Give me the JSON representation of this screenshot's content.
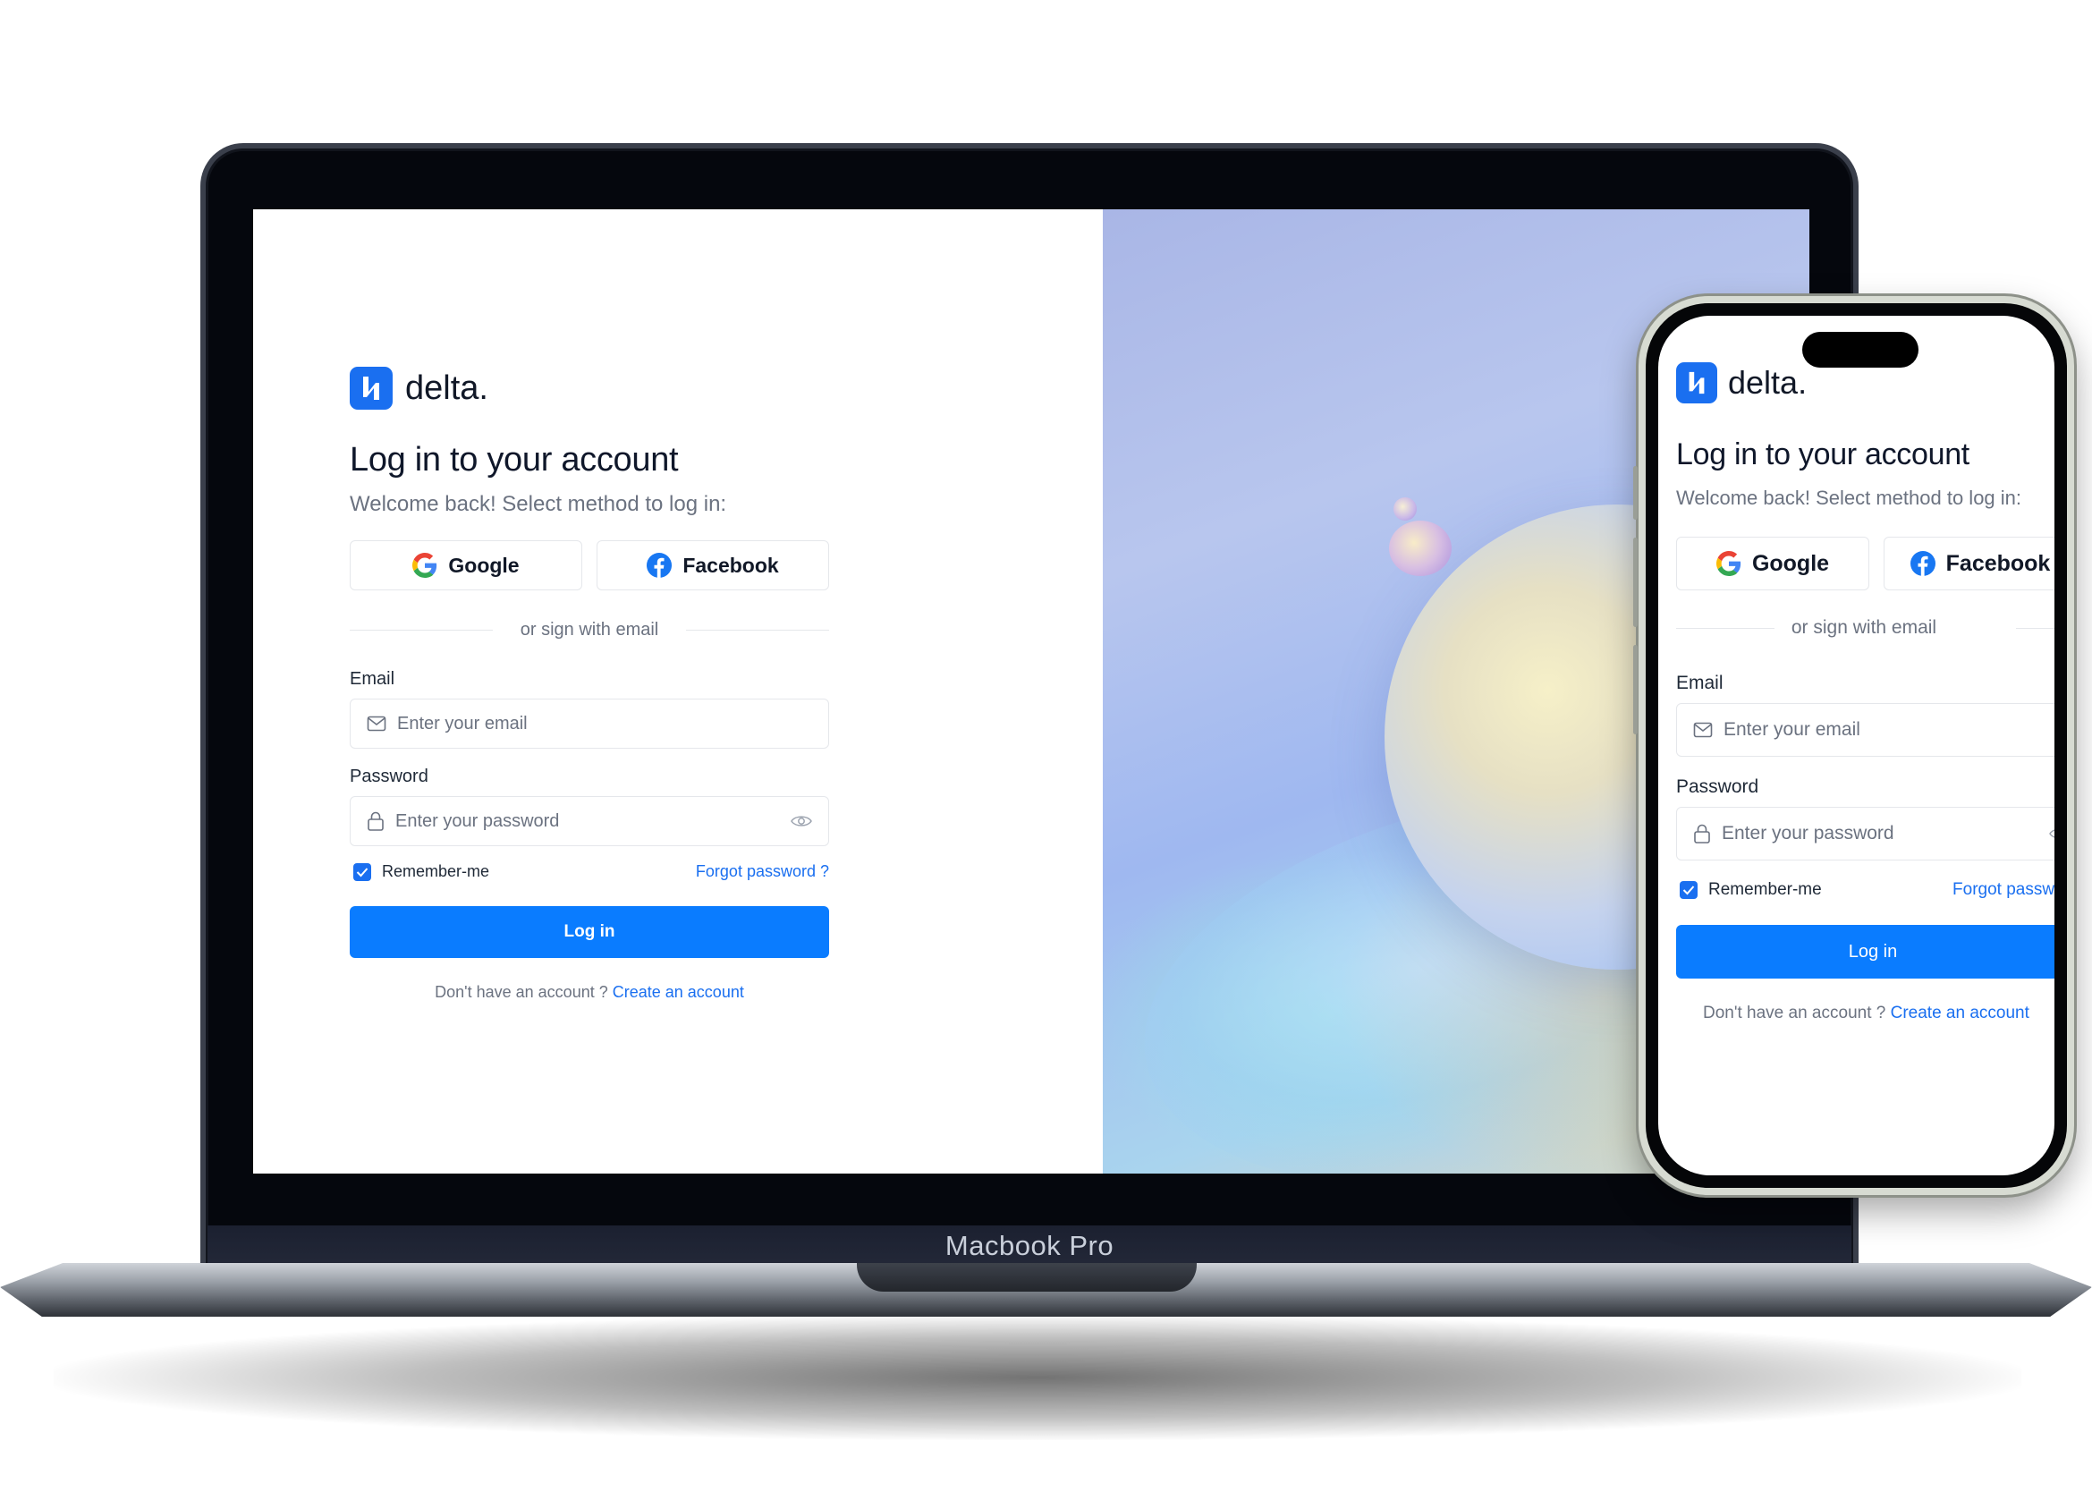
{
  "brand": {
    "name": "delta.",
    "accent": "#1a6ff0",
    "button_color": "#0a7cff"
  },
  "laptop": {
    "label": "Macbook Pro"
  },
  "login": {
    "title": "Log in to your account",
    "subtitle": "Welcome back! Select method to log in:",
    "google_label": "Google",
    "facebook_label": "Facebook",
    "divider_text": "or sign with email",
    "email_label": "Email",
    "email_placeholder": "Enter your email",
    "email_icon": "mail-icon",
    "password_label": "Password",
    "password_placeholder": "Enter your password",
    "password_icon": "lock-icon",
    "reveal_icon": "eye-icon",
    "remember_label": "Remember-me",
    "remember_checked": true,
    "forgot_label": "Forgot password ?",
    "phone_forgot_label": "Forgot passwor",
    "login_label": "Log in",
    "signup_prompt": "Don't have an account ?",
    "signup_link": "Create an account"
  }
}
